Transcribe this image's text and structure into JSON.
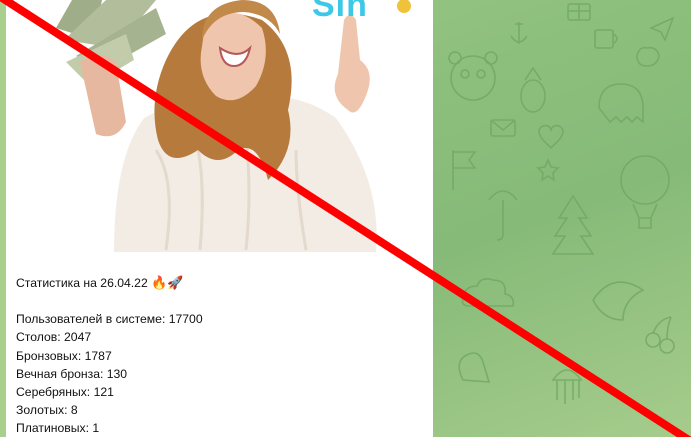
{
  "chat": {
    "background_color": "#8fbf7e",
    "pattern_icons": [
      "gift-icon",
      "anchor-icon",
      "flag-icon",
      "mug-icon",
      "paper-plane-icon",
      "strawberry-icon",
      "panda-icon",
      "pineapple-icon",
      "envelope-icon",
      "heart-icon",
      "balloon-icon",
      "tree-icon",
      "umbrella-icon",
      "star-icon",
      "ghost-icon",
      "jellyfish-icon"
    ]
  },
  "post": {
    "image_brand_text": "Sin",
    "image_icons": [
      "money-fan-icon",
      "coin-icon"
    ],
    "stats_header": "Статистика на 26.04.22",
    "stats_emojis": [
      "🔥",
      "🚀"
    ],
    "stats": [
      {
        "label": "Пользователей в системе: 17700"
      },
      {
        "label": "Столов: 2047"
      },
      {
        "label": "Бронзовых: 1787"
      },
      {
        "label": "Вечная бронза: 130"
      },
      {
        "label": "Серебряных: 121"
      },
      {
        "label": "Золотых: 8"
      },
      {
        "label": "Платиновых: 1"
      }
    ]
  },
  "overlay": {
    "cross_line_color": "#ff0000"
  }
}
